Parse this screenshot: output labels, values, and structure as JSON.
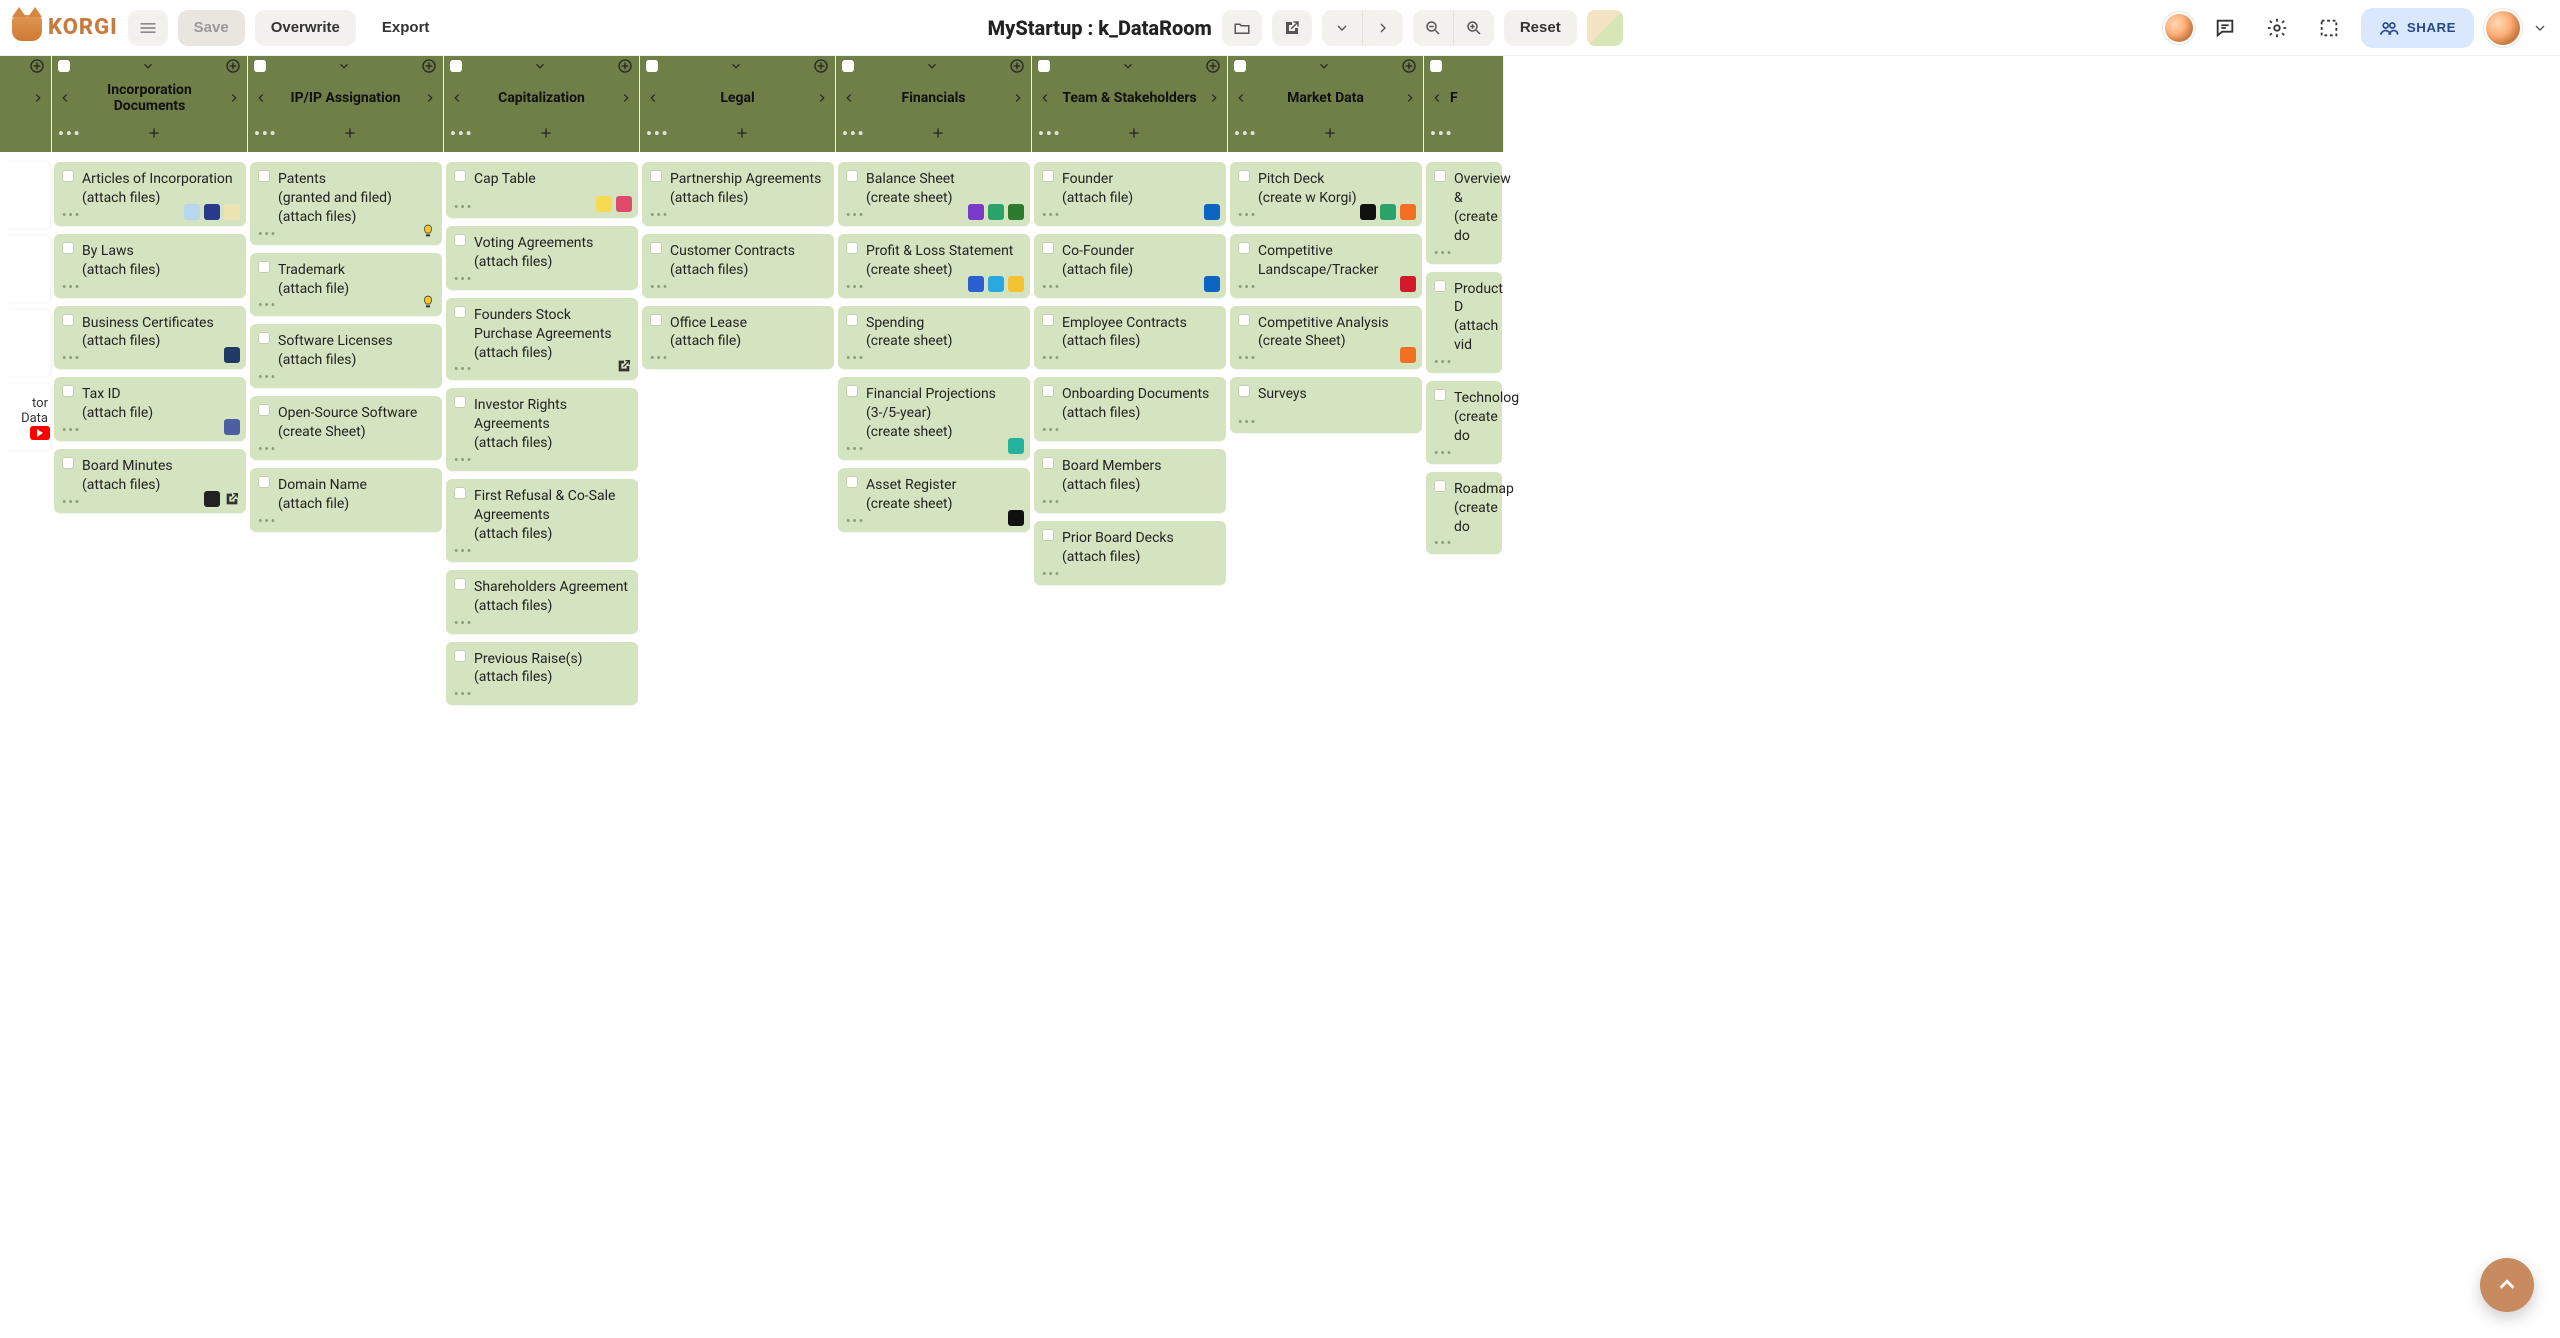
{
  "brand": "KORGI",
  "toolbar": {
    "save": "Save",
    "overwrite": "Overwrite",
    "export": "Export",
    "doc_title": "MyStartup : k_DataRoom",
    "reset": "Reset",
    "share": "SHARE"
  },
  "partial_left": {
    "peek": "tor Data"
  },
  "columns": [
    {
      "title": "Incorporation Documents",
      "cards": [
        {
          "t1": "Articles of Incorporation",
          "t2": "(attach files)",
          "badges": [
            "#b9d8ef",
            "#2a3a8a",
            "#efe3b2"
          ]
        },
        {
          "t1": "By Laws",
          "t2": "(attach files)"
        },
        {
          "t1": "Business Certificates",
          "t2": "(attach files)",
          "badges": [
            "#203a66"
          ]
        },
        {
          "t1": "Tax ID",
          "t2": "(attach file)",
          "badges": [
            "#4c5fa3"
          ]
        },
        {
          "t1": "Board Minutes",
          "t2": "(attach files)",
          "badges": [
            "#222",
            "link"
          ]
        }
      ]
    },
    {
      "title": "IP/IP Assignation",
      "cards": [
        {
          "t1": "Patents",
          "t2": "(granted and filed)",
          "t3": "(attach files)",
          "badges": [
            "bulb"
          ]
        },
        {
          "t1": "Trademark",
          "t2": "(attach file)",
          "badges": [
            "bulb"
          ]
        },
        {
          "t1": "Software Licenses",
          "t2": "(attach files)"
        },
        {
          "t1": "Open-Source Software",
          "t2": "(create Sheet)"
        },
        {
          "t1": "Domain Name",
          "t2": "(attach file)"
        }
      ]
    },
    {
      "title": "Capitalization",
      "cards": [
        {
          "t1": "Cap Table",
          "t2": "",
          "badges": [
            "#f6db52",
            "#e04a6b"
          ]
        },
        {
          "t1": "Voting Agreements",
          "t2": "(attach files)"
        },
        {
          "t1": "Founders Stock Purchase Agreements",
          "t2": "(attach files)",
          "badges": [
            "link"
          ]
        },
        {
          "t1": "Investor Rights Agreements",
          "t2": "(attach files)"
        },
        {
          "t1": "First Refusal & Co-Sale Agreements",
          "t2": "(attach files)"
        },
        {
          "t1": "Shareholders Agreement",
          "t2": "(attach files)"
        },
        {
          "t1": "Previous Raise(s)",
          "t2": "(attach files)"
        }
      ]
    },
    {
      "title": "Legal",
      "cards": [
        {
          "t1": "Partnership Agreements",
          "t2": "(attach files)"
        },
        {
          "t1": "Customer Contracts",
          "t2": "(attach files)"
        },
        {
          "t1": "Office Lease",
          "t2": "(attach file)"
        }
      ]
    },
    {
      "title": "Financials",
      "cards": [
        {
          "t1": "Balance Sheet",
          "t2": "(create sheet)",
          "badges": [
            "#7a39c9",
            "#2aa36a",
            "#2c7a2c"
          ]
        },
        {
          "t1": "Profit & Loss Statement",
          "t2": "(create sheet)",
          "badges": [
            "#2a5fd1",
            "#2aa9e0",
            "#f3c333"
          ]
        },
        {
          "t1": "Spending",
          "t2": "(create sheet)"
        },
        {
          "t1": "Financial Projections (3-/5-year)",
          "t2": "(create sheet)",
          "badges": [
            "#23b39c"
          ]
        },
        {
          "t1": "Asset Register",
          "t2": "(create sheet)",
          "badges": [
            "#111"
          ]
        }
      ]
    },
    {
      "title": "Team & Stakeholders",
      "cards": [
        {
          "t1": "Founder",
          "t2": "(attach file)",
          "badges": [
            "#0a66c2"
          ]
        },
        {
          "t1": "Co-Founder",
          "t2": "(attach file)",
          "badges": [
            "#0a66c2"
          ]
        },
        {
          "t1": "Employee Contracts",
          "t2": "(attach files)"
        },
        {
          "t1": "Onboarding Documents",
          "t2": "(attach files)"
        },
        {
          "t1": "Board Members",
          "t2": "(attach files)"
        },
        {
          "t1": "Prior Board Decks",
          "t2": "(attach files)"
        }
      ]
    },
    {
      "title": "Market Data",
      "cards": [
        {
          "t1": "Pitch Deck",
          "t2": "(create w Korgi)",
          "badges": [
            "#111",
            "#2aa36a",
            "#f36f21"
          ]
        },
        {
          "t1": "Competitive Landscape/Tracker",
          "t2": "",
          "badges": [
            "#d11a2a"
          ]
        },
        {
          "t1": "Competitive Analysis",
          "t2": "(create Sheet)",
          "badges": [
            "#f36f21"
          ]
        },
        {
          "t1": "Surveys",
          "t2": ""
        }
      ]
    }
  ],
  "partial_right": {
    "cards": [
      {
        "t1": "Overview &",
        "t2": "(create do"
      },
      {
        "t1": "Product D",
        "t2": "(attach vid"
      },
      {
        "t1": "Technolog",
        "t2": "(create do"
      },
      {
        "t1": "Roadmap",
        "t2": "(create do"
      }
    ]
  }
}
